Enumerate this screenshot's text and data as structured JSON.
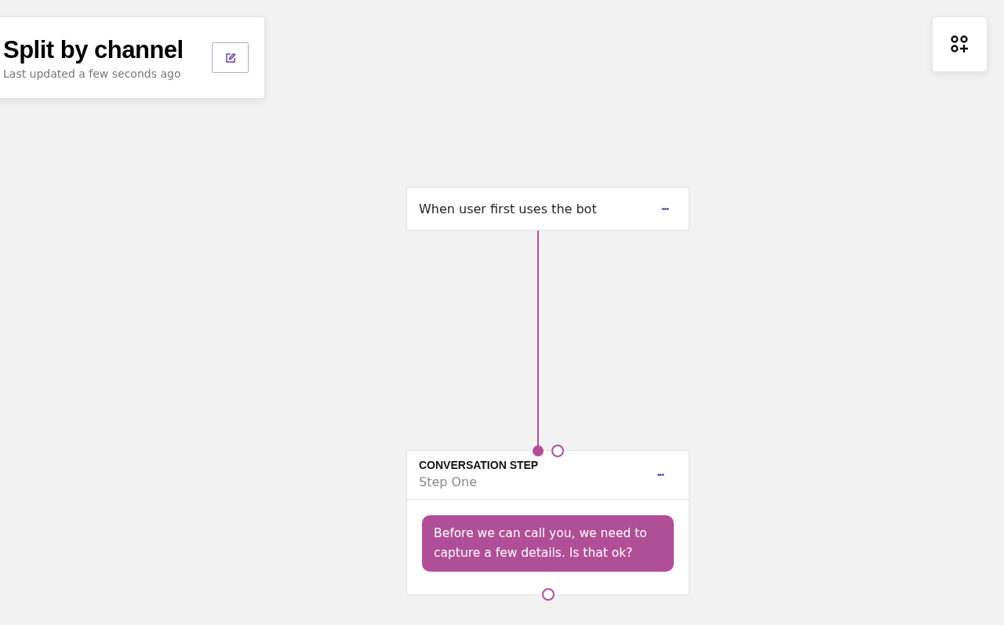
{
  "header": {
    "title": "Split by channel",
    "subtitle": "Last updated a few seconds ago"
  },
  "trigger": {
    "text": "When user first uses the bot",
    "menu": "•••"
  },
  "step": {
    "type_label": "CONVERSATION STEP",
    "name": "Step One",
    "menu": "•••",
    "message": "Before we can call you, we need to capture a few details. Is that ok?"
  }
}
